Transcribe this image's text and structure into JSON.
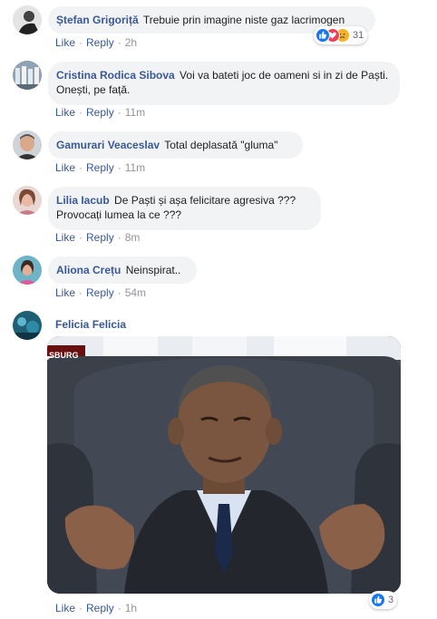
{
  "comments": [
    {
      "author": "Ștefan Grigoriță",
      "text": "Trebuie prin imagine niste gaz lacrimogen",
      "like": "Like",
      "reply": "Reply",
      "time": "2h",
      "reactions": "31"
    },
    {
      "author": "Cristina Rodica Sibova",
      "text": "Voi va bateti joc de oameni si in zi de Paști. Onești, pe față.",
      "like": "Like",
      "reply": "Reply",
      "time": "11m"
    },
    {
      "author": "Gamurari Veaceslav",
      "text": "Total deplasată \"gluma\"",
      "like": "Like",
      "reply": "Reply",
      "time": "11m"
    },
    {
      "author": "Lilia Iacub",
      "text": "De Paști și așa felicitare agresiva ??? Provocați lumea la ce ???",
      "like": "Like",
      "reply": "Reply",
      "time": "8m"
    },
    {
      "author": "Aliona Crețu",
      "text": "Neinspirat..",
      "like": "Like",
      "reply": "Reply",
      "time": "54m"
    },
    {
      "author": "Felicia Felicia",
      "like": "Like",
      "reply": "Reply",
      "time": "1h",
      "reactions": "3",
      "image_watermark": "SBURG"
    }
  ],
  "colors": {
    "name": "#385898",
    "bubble": "#f2f3f5",
    "meta": "#90949c",
    "like_blue": "#1877f2",
    "love_red": "#f33e58",
    "sad_yellow": "#f7b125"
  }
}
